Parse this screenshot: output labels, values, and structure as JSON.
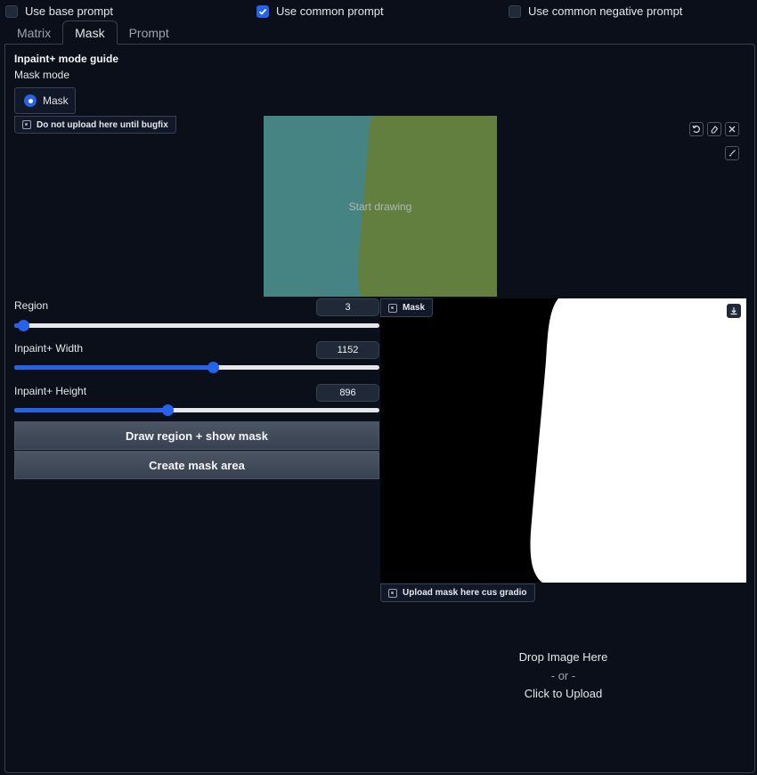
{
  "checkboxes": [
    {
      "label": "Use base prompt",
      "checked": false
    },
    {
      "label": "Use common prompt",
      "checked": true
    },
    {
      "label": "Use common negative prompt",
      "checked": false
    }
  ],
  "tabs": [
    {
      "label": "Matrix",
      "active": false
    },
    {
      "label": "Mask",
      "active": true
    },
    {
      "label": "Prompt",
      "active": false
    }
  ],
  "guide_title": "Inpaint+ mode guide",
  "mask_mode": {
    "label": "Mask mode",
    "option": "Mask",
    "selected": true
  },
  "canvas": {
    "label": "Do not upload here until bugfix",
    "hint": "Start drawing",
    "colors": {
      "left": "#468484",
      "right": "#627f40"
    },
    "icons": [
      "undo-icon",
      "eraser-icon",
      "close-icon",
      "brush-icon"
    ]
  },
  "sliders": [
    {
      "label": "Region",
      "value": "3",
      "fraction": 0.025
    },
    {
      "label": "Inpaint+ Width",
      "value": "1152",
      "fraction": 0.545
    },
    {
      "label": "Inpaint+ Height",
      "value": "896",
      "fraction": 0.42
    }
  ],
  "buttons": {
    "draw_region": "Draw region + show mask",
    "create_mask": "Create mask area"
  },
  "mask_output": {
    "label": "Mask",
    "icon": "download-icon"
  },
  "upload": {
    "label": "Upload mask here cus gradio",
    "drop": "Drop Image Here",
    "or": "- or -",
    "click": "Click to Upload"
  },
  "colors": {
    "accent": "#2563eb",
    "background": "#0b0f19",
    "border": "#374151"
  }
}
